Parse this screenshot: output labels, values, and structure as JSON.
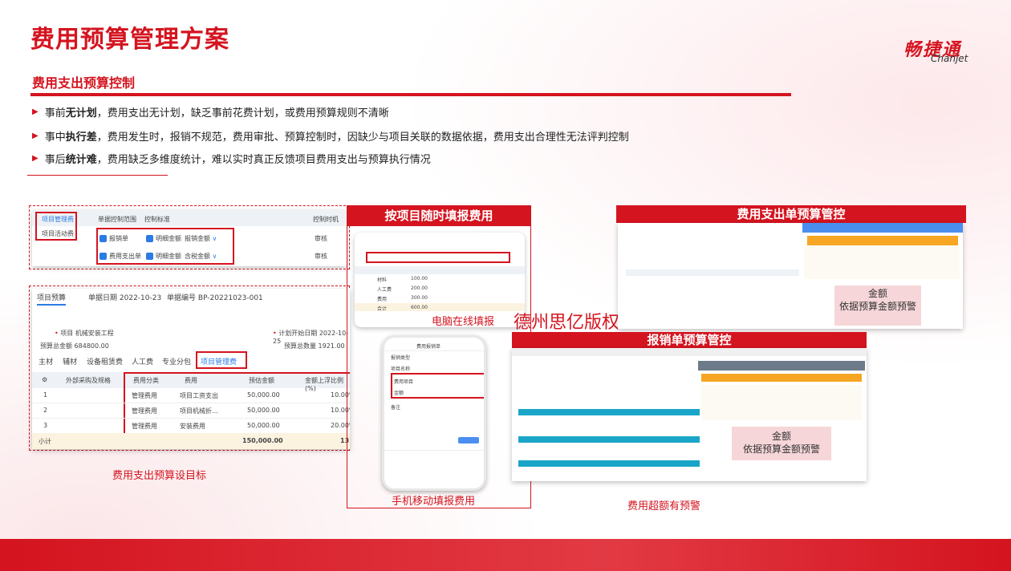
{
  "header": {
    "title": "费用预算管理方案",
    "logo_cn": "畅捷通",
    "logo_en": "Chanjet",
    "subtitle": "费用支出预算控制"
  },
  "bullets": [
    {
      "pre": "事前",
      "bold": "无计划",
      "rest": "，费用支出无计划，缺乏事前花费计划，或费用预算规则不清晰"
    },
    {
      "pre": "事中",
      "bold": "执行差",
      "rest": "，费用发生时，报销不规范，费用审批、预算控制时，因缺少与项目关联的数据依据，费用支出合理性无法评判控制"
    },
    {
      "pre": "事后",
      "bold": "统计难",
      "rest": "，费用缺乏多维度统计，难以实时真正反馈项目费用支出与预算执行情况"
    }
  ],
  "left_panel_top": {
    "menu": [
      "项目管理费",
      "项目活动费"
    ],
    "headers": [
      "单据控制范围",
      "控制标准",
      "控制时机"
    ],
    "rows": [
      {
        "doc": "报销单",
        "basis": "明细金额",
        "std": "报销金额",
        "timing": "审核"
      },
      {
        "doc": "费用支出单",
        "basis": "明细金额",
        "std": "含税金额",
        "timing": "审核"
      }
    ]
  },
  "left_panel_bottom": {
    "tab": "项目预算",
    "date_label": "单据日期",
    "date": "2022-10-23",
    "code_label": "单据编号",
    "code": "BP-20221023-001",
    "project_label": "项目",
    "project": "机械安装工程",
    "plan_label": "计划开始日期",
    "plan": "2022-10-25",
    "total_label": "预算总金额",
    "total": "684800.00",
    "qty_label": "预算总数量",
    "qty": "1921.00",
    "tabs": [
      "主材",
      "辅材",
      "设备租赁费",
      "人工费",
      "专业分包",
      "项目管理费"
    ],
    "cols": [
      "外部采购及规格",
      "费用分类",
      "费用",
      "预估金额",
      "金额上浮比例(%)"
    ],
    "rows": [
      {
        "no": "1",
        "cat": "管理费用",
        "fee": "项目工资支出",
        "amt": "50,000.00",
        "pct": "10.00%"
      },
      {
        "no": "2",
        "cat": "管理费用",
        "fee": "项目机械折…",
        "amt": "50,000.00",
        "pct": "10.00%"
      },
      {
        "no": "3",
        "cat": "管理费用",
        "fee": "安装费用",
        "amt": "50,000.00",
        "pct": "20.00%"
      }
    ],
    "sum_label": "小计",
    "sum": "150,000.00",
    "sum_right": "13"
  },
  "caption_left": "费用支出预算设目标",
  "middle": {
    "bar": "按项目随时填报费用",
    "pc_caption": "电脑在线填报",
    "mobile_caption": "手机移动填报费用",
    "pc_rows": [
      "材料",
      "人工费",
      "费用",
      "合计"
    ],
    "pc_amounts": [
      "100.00",
      "200.00",
      "300.00",
      "600.00"
    ],
    "phone_title": "费用报销单",
    "phone_rows": [
      "报销类型",
      "项目名称",
      "费用项目",
      "金额",
      "备注"
    ]
  },
  "watermark": "德州思亿版权",
  "right_top": {
    "bar": "费用支出单预算管控",
    "note": "金额\n依据预算金额预警"
  },
  "right_bottom": {
    "bar": "报销单预算管控",
    "note": "金额\n依据预算金额预警"
  },
  "caption_right": "费用超额有预警",
  "colors": {
    "brand": "#d4141f",
    "blue": "#2b7be4",
    "orange": "#f6a623",
    "teal": "#1aa5c8"
  }
}
